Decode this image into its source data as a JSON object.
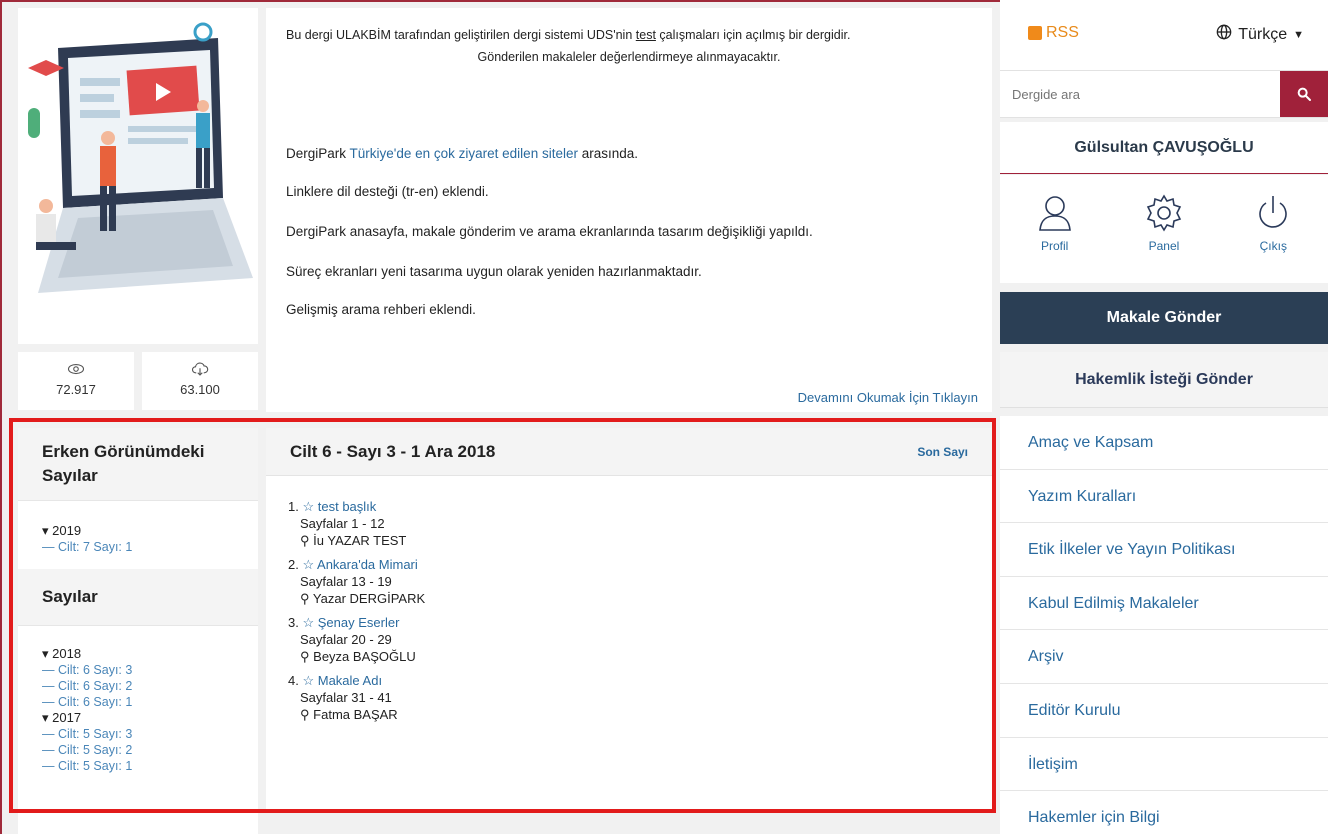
{
  "stats": {
    "views": "72.917",
    "downloads": "63.100"
  },
  "notice": {
    "line1_pre": "Bu dergi ULAKBİM tarafından geliştirilen dergi sistemi UDS'nin ",
    "line1_link": "test",
    "line1_post": " çalışmaları için açılmış bir dergidir.",
    "line2": "Gönderilen makaleler değerlendirmeye alınmayacaktır.",
    "p1_pre": "DergiPark ",
    "p1_link": "Türkiye'de en çok ziyaret edilen siteler",
    "p1_post": " arasında.",
    "p2": "Linklere dil desteği (tr-en) eklendi.",
    "p3": "DergiPark anasayfa, makale gönderim ve arama ekranlarında tasarım değişikliği yapıldı.",
    "p4": "Süreç ekranları yeni tasarıma uygun olarak yeniden hazırlanmaktadır.",
    "p5": "Gelişmiş arama rehberi eklendi.",
    "more": "Devamını Okumak İçin Tıklayın"
  },
  "early": {
    "title": "Erken Görünümdeki Sayılar",
    "year": "2019",
    "issue": "Cilt: 7 Sayı: 1"
  },
  "issues": {
    "title": "Sayılar",
    "years": [
      {
        "year": "2018",
        "items": [
          "Cilt: 6 Sayı: 3",
          "Cilt: 6 Sayı: 2",
          "Cilt: 6 Sayı: 1"
        ]
      },
      {
        "year": "2017",
        "items": [
          "Cilt: 5 Sayı: 3",
          "Cilt: 5 Sayı: 2",
          "Cilt: 5 Sayı: 1"
        ]
      }
    ]
  },
  "current": {
    "title": "Cilt 6 - Sayı 3 - 1 Ara 2018",
    "last_label": "Son Sayı",
    "articles": [
      {
        "num": "1.",
        "title": "test başlık",
        "pages": "Sayfalar 1 - 12",
        "author": "İu YAZAR TEST"
      },
      {
        "num": "2.",
        "title": "Ankara'da Mimari",
        "pages": "Sayfalar 13 - 19",
        "author": "Yazar DERGİPARK"
      },
      {
        "num": "3.",
        "title": "Şenay Eserler",
        "pages": "Sayfalar 20 - 29",
        "author": "Beyza BAŞOĞLU"
      },
      {
        "num": "4.",
        "title": "Makale Adı",
        "pages": "Sayfalar 31 - 41",
        "author": "Fatma BAŞAR"
      }
    ]
  },
  "sidebar": {
    "rss": "RSS",
    "language": "Türkçe",
    "search_placeholder": "Dergide ara",
    "user": "Gülsultan ÇAVUŞOĞLU",
    "profile": "Profil",
    "panel": "Panel",
    "logout": "Çıkış",
    "submit": "Makale Gönder",
    "review": "Hakemlik İsteği Gönder",
    "menu": [
      "Amaç ve Kapsam",
      "Yazım Kuralları",
      "Etik İlkeler ve Yayın Politikası",
      "Kabul Edilmiş Makaleler",
      "Arşiv",
      "Editör Kurulu",
      "İletişim",
      "Hakemler için Bilgi"
    ]
  },
  "colors": {
    "brand": "#a0213a",
    "link": "#2a6a9e",
    "navy": "#2b3f55",
    "highlight": "#e21b1b",
    "rss": "#f08a1a"
  }
}
